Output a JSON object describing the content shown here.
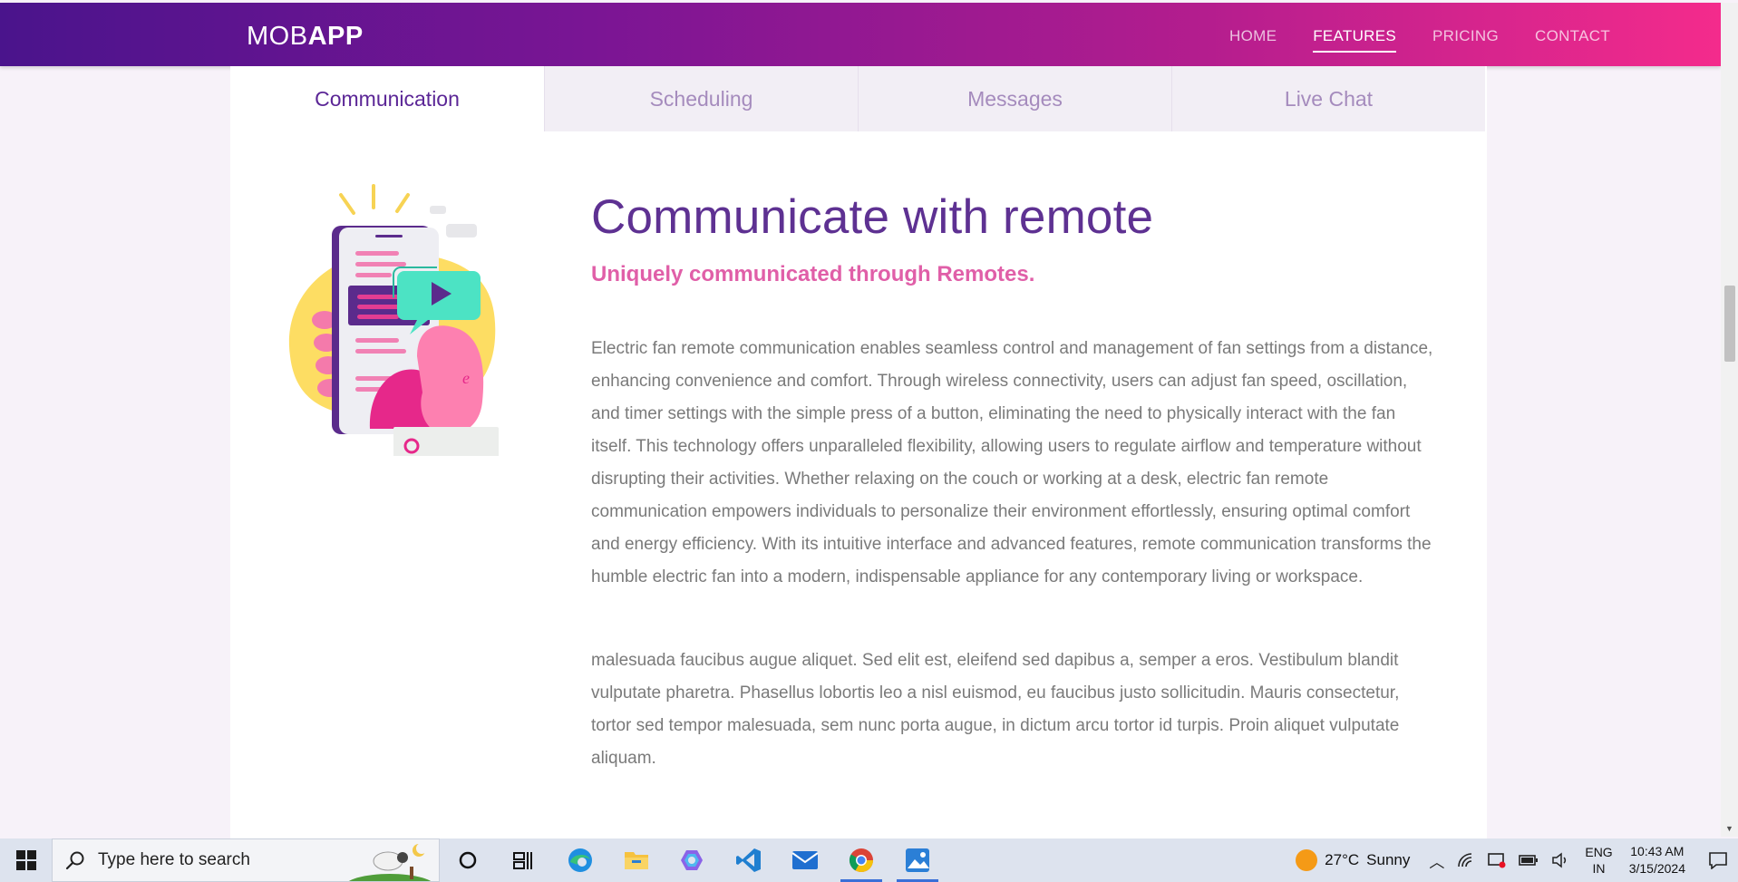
{
  "nav": {
    "brand_light": "MOB",
    "brand_bold": "APP",
    "links": [
      {
        "label": "HOME"
      },
      {
        "label": "FEATURES"
      },
      {
        "label": "PRICING"
      },
      {
        "label": "CONTACT"
      }
    ],
    "active_link": "FEATURES"
  },
  "tabs": [
    {
      "label": "Communication"
    },
    {
      "label": "Scheduling"
    },
    {
      "label": "Messages"
    },
    {
      "label": "Live Chat"
    }
  ],
  "active_tab": "Communication",
  "content": {
    "heading": "Communicate with remote",
    "subheading": "Uniquely communicated through Remotes.",
    "paragraph1": "Electric fan remote communication enables seamless control and management of fan settings from a distance, enhancing convenience and comfort. Through wireless connectivity, users can adjust fan speed, oscillation, and timer settings with the simple press of a button, eliminating the need to physically interact with the fan itself. This technology offers unparalleled flexibility, allowing users to regulate airflow and temperature without disrupting their activities. Whether relaxing on the couch or working at a desk, electric fan remote communication empowers individuals to personalize their environment effortlessly, ensuring optimal comfort and energy efficiency. With its intuitive interface and advanced features, remote communication transforms the humble electric fan into a modern, indispensable appliance for any contemporary living or workspace.",
    "paragraph2": "malesuada faucibus augue aliquet. Sed elit est, eleifend sed dapibus a, semper a eros. Vestibulum blandit vulputate pharetra. Phasellus lobortis leo a nisl euismod, eu faucibus justo sollicitudin. Mauris consectetur, tortor sed tempor malesuada, sem nunc porta augue, in dictum arcu tortor id turpis. Proin aliquet vulputate aliquam."
  },
  "taskbar": {
    "search_placeholder": "Type here to search",
    "apps": [
      "task-view-icon",
      "edge-icon",
      "file-explorer-icon",
      "copilot-icon",
      "vscode-icon",
      "mail-icon",
      "chrome-icon",
      "photos-icon"
    ],
    "weather": {
      "temp": "27°C",
      "condition": "Sunny"
    },
    "language": {
      "line1": "ENG",
      "line2": "IN"
    },
    "clock": {
      "time": "10:43 AM",
      "date": "3/15/2024"
    }
  },
  "colors": {
    "nav_gradient_start": "#4a148c",
    "nav_gradient_end": "#f42b8c",
    "heading": "#5e3192",
    "subheading": "#e05fa8",
    "body_text": "#7a7a7a",
    "active_tab_text": "#5b2696",
    "inactive_tab_text": "#a58bbd"
  }
}
